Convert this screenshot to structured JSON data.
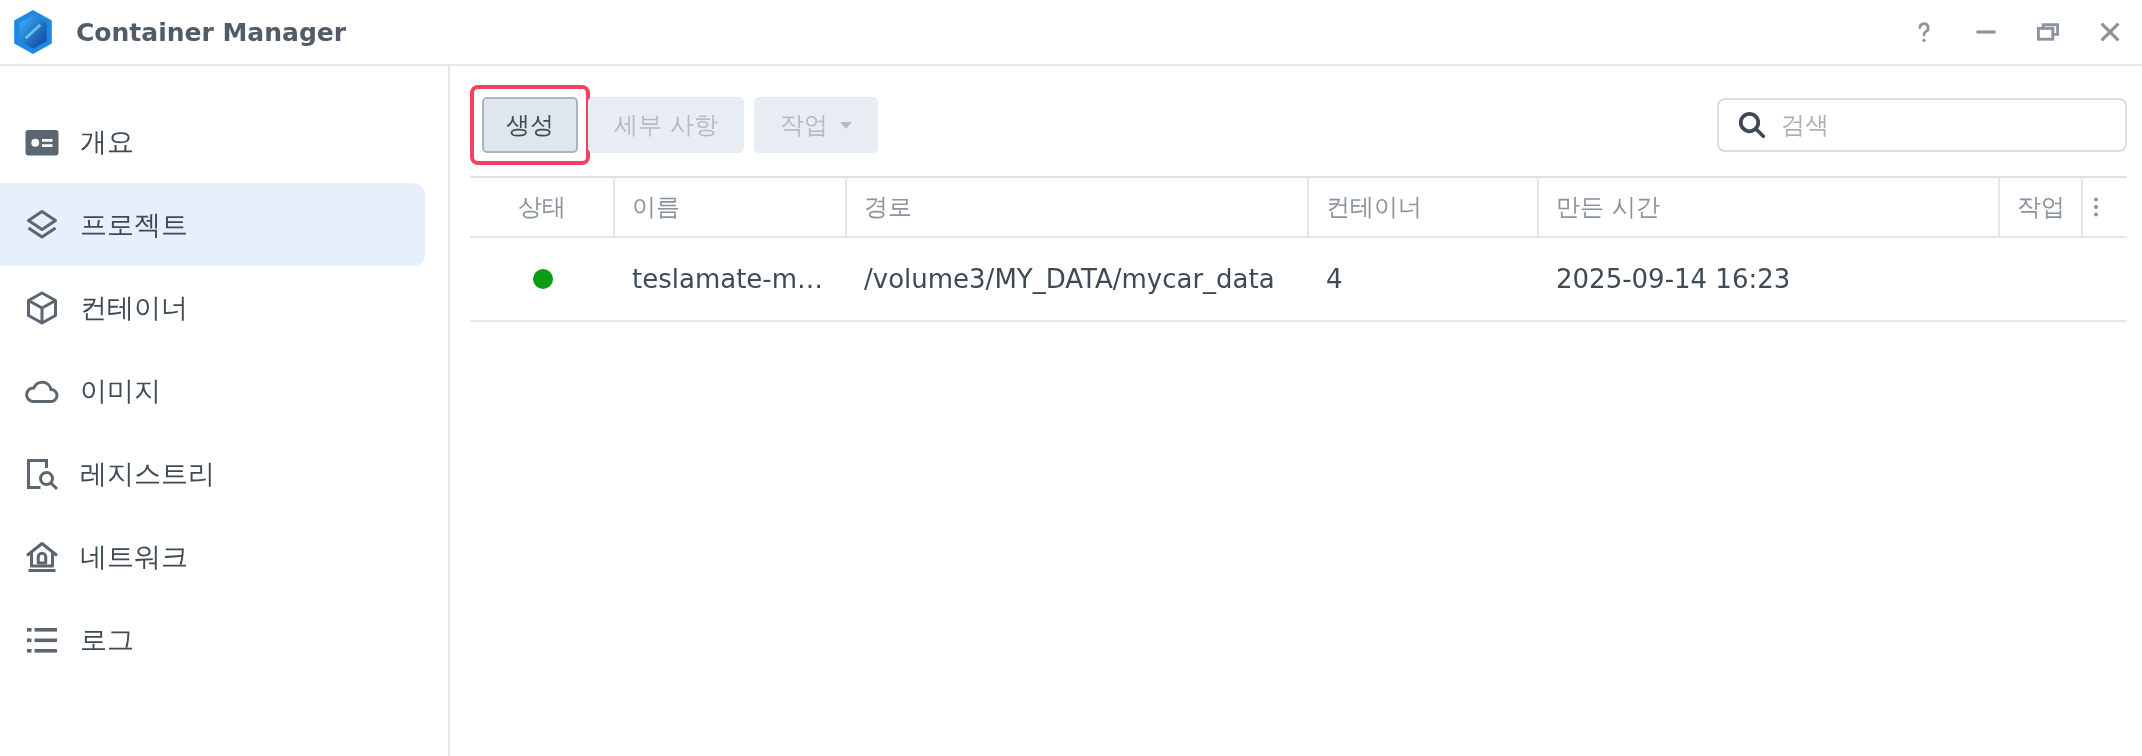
{
  "window": {
    "title": "Container Manager",
    "controls": [
      {
        "kind": "help"
      },
      {
        "kind": "minimize"
      },
      {
        "kind": "restore"
      },
      {
        "kind": "close"
      }
    ]
  },
  "sidebar": {
    "items": [
      {
        "label": "개요",
        "kind": "overview",
        "selected": false
      },
      {
        "label": "프로젝트",
        "kind": "layers",
        "selected": true
      },
      {
        "label": "컨테이너",
        "kind": "cube",
        "selected": false
      },
      {
        "label": "이미지",
        "kind": "cloud",
        "selected": false
      },
      {
        "label": "레지스트리",
        "kind": "registry",
        "selected": false
      },
      {
        "label": "네트워크",
        "kind": "network",
        "selected": false
      },
      {
        "label": "로그",
        "kind": "list",
        "selected": false
      }
    ]
  },
  "toolbar": {
    "buttons": [
      {
        "label": "생성",
        "disabled": false,
        "highlighted": true,
        "dropdown": false
      },
      {
        "label": "세부 사항",
        "disabled": true,
        "highlighted": false,
        "dropdown": false
      },
      {
        "label": "작업",
        "disabled": true,
        "highlighted": false,
        "dropdown": true
      }
    ],
    "search": {
      "placeholder": "검색"
    }
  },
  "table": {
    "columns": [
      "상태",
      "이름",
      "경로",
      "컨테이너",
      "만든 시간",
      "작업"
    ],
    "rows": [
      {
        "color": "#0a9c14",
        "name": "teslamate-m…",
        "path": "/volume3/MY_DATA/mycar_data",
        "containers": "4",
        "created": "2025-09-14 16:23"
      }
    ]
  }
}
